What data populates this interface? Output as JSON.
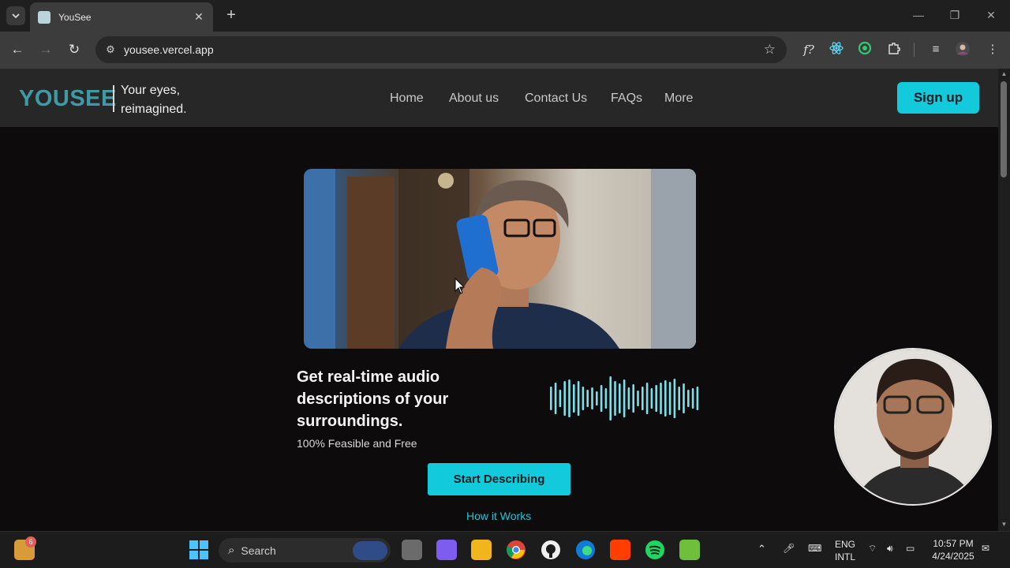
{
  "browser": {
    "tab_title": "YouSee",
    "url": "yousee.vercel.app"
  },
  "site": {
    "logo": "YOUSEE",
    "tagline": "Your eyes, reimagined.",
    "nav": [
      "Home",
      "About us",
      "Contact Us",
      "FAQs",
      "More"
    ],
    "signup_label": "Sign up"
  },
  "hero": {
    "headline": "Get real-time audio descriptions of your surroundings.",
    "subline": "100% Feasible and Free",
    "start_label": "Start Describing",
    "how_label": "How it Works"
  },
  "taskbar": {
    "search_label": "Search",
    "notification_count": "6",
    "lang_line1": "ENG",
    "lang_line2": "INTL",
    "time": "10:57 PM",
    "date": "4/24/2025"
  },
  "colors": {
    "accent": "#13c9dc",
    "logo": "#3f9aa6",
    "page_bg": "#0d0b0b",
    "header_bg": "#272727"
  }
}
